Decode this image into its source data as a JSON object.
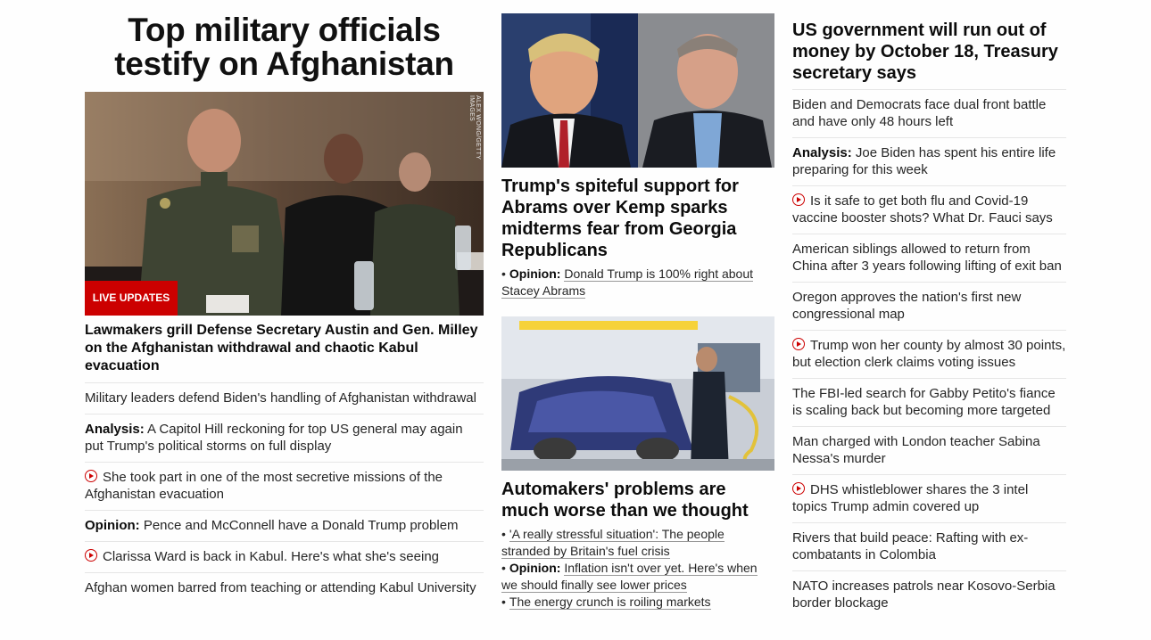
{
  "col1": {
    "headline": "Top military officials testify on Afghanistan",
    "photo_credit": "ALEX WONG/GETTY IMAGES",
    "live_label": "LIVE UPDATES",
    "lead": "Lawmakers grill Defense Secretary Austin and Gen. Milley on the Afghanistan withdrawal and chaotic Kabul evacuation",
    "items": [
      {
        "kicker": "",
        "video": false,
        "text": "Military leaders defend Biden's handling of Afghanistan withdrawal"
      },
      {
        "kicker": "Analysis:",
        "video": false,
        "text": "A Capitol Hill reckoning for top US general may again put Trump's political storms on full display"
      },
      {
        "kicker": "",
        "video": true,
        "text": "She took part in one of the most secretive missions of the Afghanistan evacuation"
      },
      {
        "kicker": "Opinion:",
        "video": false,
        "text": "Pence and McConnell have a Donald Trump problem"
      },
      {
        "kicker": "",
        "video": true,
        "text": "Clarissa Ward is back in Kabul. Here's what she's seeing"
      },
      {
        "kicker": "",
        "video": false,
        "text": "Afghan women barred from teaching or attending Kabul University"
      }
    ]
  },
  "col2": {
    "story1": {
      "headline": "Trump's spiteful support for Abrams over Kemp sparks midterms fear from Georgia Republicans",
      "bullets": [
        {
          "kicker": "Opinion:",
          "text": "Donald Trump is 100% right about Stacey Abrams"
        }
      ]
    },
    "story2": {
      "headline": "Automakers' problems are much worse than we thought",
      "bullets": [
        {
          "kicker": "",
          "text": "'A really stressful situation': The people stranded by Britain's fuel crisis"
        },
        {
          "kicker": "Opinion:",
          "text": "Inflation isn't over yet. Here's when we should finally see lower prices"
        },
        {
          "kicker": "",
          "text": "The energy crunch is roiling markets"
        }
      ]
    }
  },
  "col3": {
    "headline": "US government will run out of money by October 18, Treasury secretary says",
    "items": [
      {
        "kicker": "",
        "video": false,
        "text": "Biden and Democrats face dual front battle and have only 48 hours left"
      },
      {
        "kicker": "Analysis:",
        "video": false,
        "text": "Joe Biden has spent his entire life preparing for this week"
      },
      {
        "kicker": "",
        "video": true,
        "text": "Is it safe to get both flu and Covid-19 vaccine booster shots? What Dr. Fauci says"
      },
      {
        "kicker": "",
        "video": false,
        "text": "American siblings allowed to return from China after 3 years following lifting of exit ban"
      },
      {
        "kicker": "",
        "video": false,
        "text": "Oregon approves the nation's first new congressional map"
      },
      {
        "kicker": "",
        "video": true,
        "text": "Trump won her county by almost 30 points, but election clerk claims voting issues"
      },
      {
        "kicker": "",
        "video": false,
        "text": "The FBI-led search for Gabby Petito's fiance is scaling back but becoming more targeted"
      },
      {
        "kicker": "",
        "video": false,
        "text": "Man charged with London teacher Sabina Nessa's murder"
      },
      {
        "kicker": "",
        "video": true,
        "text": "DHS whistleblower shares the 3 intel topics Trump admin covered up"
      },
      {
        "kicker": "",
        "video": false,
        "text": "Rivers that build peace: Rafting with ex-combatants in Colombia"
      },
      {
        "kicker": "",
        "video": false,
        "text": "NATO increases patrols near Kosovo-Serbia border blockage"
      }
    ]
  },
  "colors": {
    "accent": "#cc0000",
    "divider": "#e6e6e6",
    "text": "#0c0c0c"
  }
}
